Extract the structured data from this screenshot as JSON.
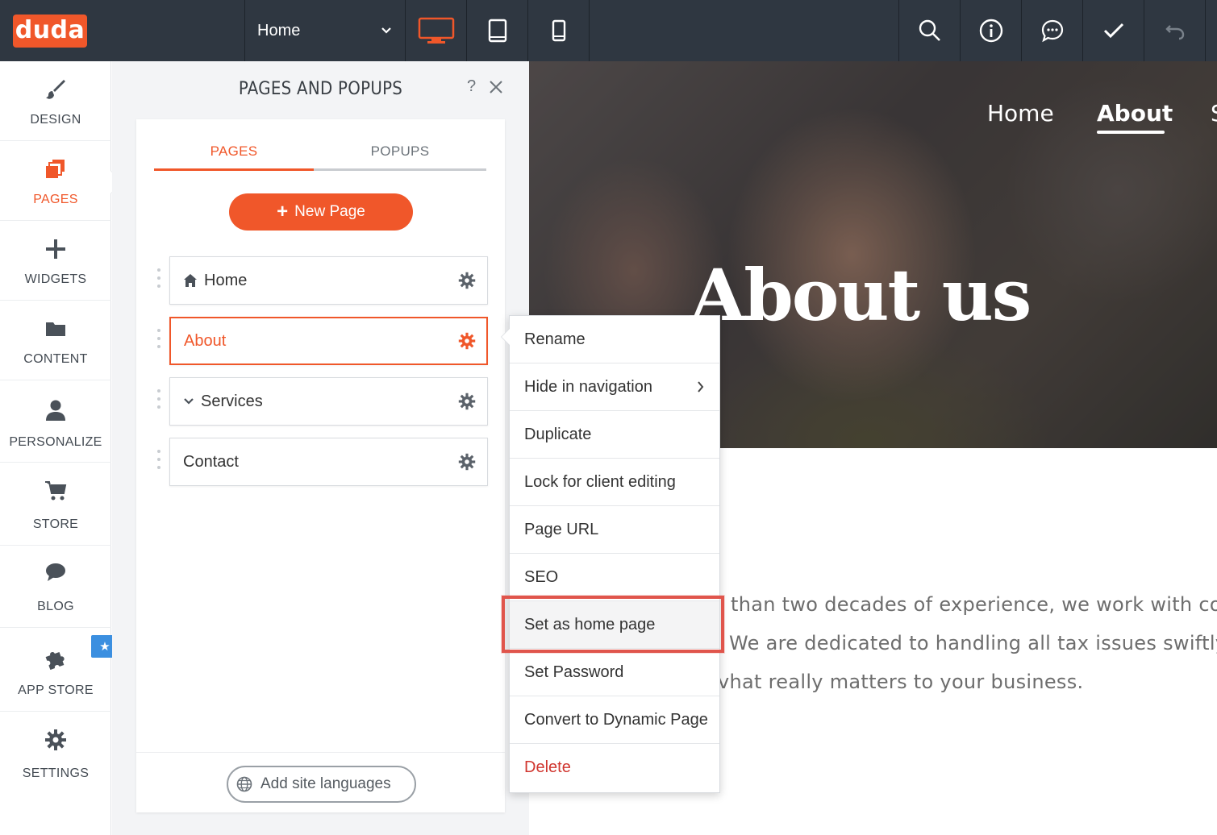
{
  "app": {
    "logo": "duda"
  },
  "toolbar": {
    "page_select": "Home",
    "buttons": [
      "desktop-view",
      "tablet-view",
      "mobile-view",
      "search",
      "info",
      "comments",
      "publish-check",
      "undo"
    ]
  },
  "sidebar": {
    "items": [
      {
        "label": "DESIGN",
        "icon": "brush-icon"
      },
      {
        "label": "PAGES",
        "icon": "pages-icon",
        "active": true
      },
      {
        "label": "WIDGETS",
        "icon": "plus-icon"
      },
      {
        "label": "CONTENT",
        "icon": "folder-icon"
      },
      {
        "label": "PERSONALIZE",
        "icon": "person-icon"
      },
      {
        "label": "STORE",
        "icon": "cart-icon"
      },
      {
        "label": "BLOG",
        "icon": "speech-bubble-icon"
      },
      {
        "label": "APP STORE",
        "icon": "puzzle-icon"
      },
      {
        "label": "SETTINGS",
        "icon": "gear-icon"
      }
    ]
  },
  "panel": {
    "title": "PAGES AND POPUPS",
    "help": "?",
    "tabs": {
      "pages": "PAGES",
      "popups": "POPUPS"
    },
    "new_page": "New Page",
    "pages": [
      {
        "label": "Home"
      },
      {
        "label": "About",
        "selected": true
      },
      {
        "label": "Services"
      },
      {
        "label": "Contact"
      }
    ],
    "add_languages": "Add site languages"
  },
  "site": {
    "nav": {
      "home": "Home",
      "about": "About",
      "partial": "S"
    },
    "hero_title": "About us",
    "body_lines": [
      "than two decades of experience, we work with compa",
      "We are dedicated to handling all tax issues swiftly an",
      "vhat really matters to your business."
    ]
  },
  "context_menu": {
    "items": [
      "Rename",
      "Hide in navigation",
      "Duplicate",
      "Lock for client editing",
      "Page URL",
      "SEO",
      "Set as home page",
      "Set Password",
      "Convert to Dynamic Page",
      "Delete"
    ],
    "highlighted": "Set as home page"
  },
  "colors": {
    "brand": "#f0572a",
    "topbar": "#2f3741",
    "danger": "#d0362f",
    "highlight_border": "#e0554c",
    "badge": "#3b8fe0"
  }
}
